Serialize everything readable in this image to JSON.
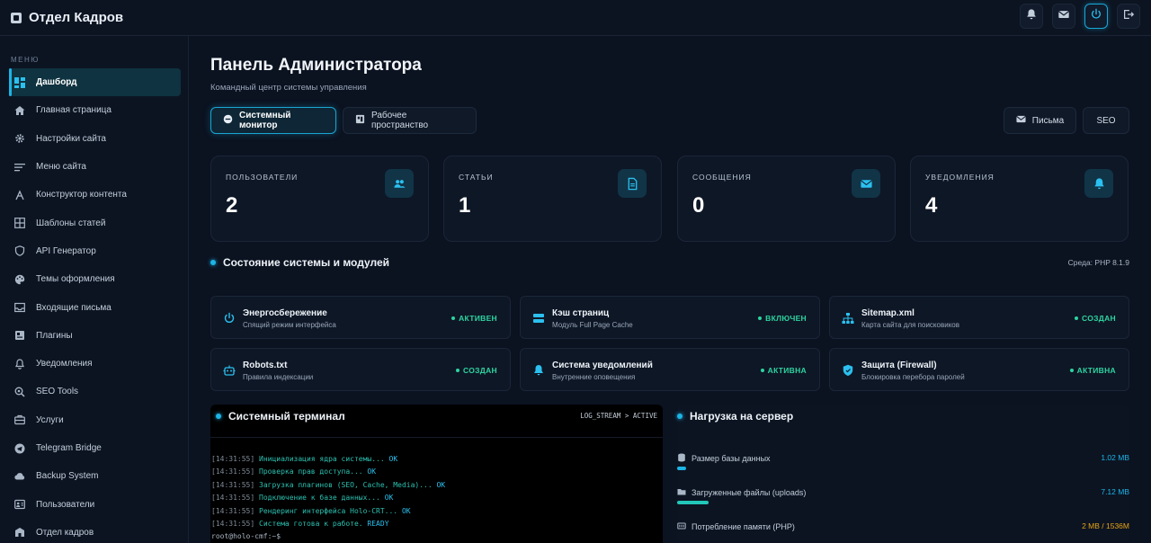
{
  "app": {
    "title": "Отдел Кадров"
  },
  "sidebar": {
    "menu_label": "МЕНЮ",
    "items": [
      {
        "label": "Дашборд",
        "icon": "dashboard-icon",
        "active": true
      },
      {
        "label": "Главная страница",
        "icon": "home-icon"
      },
      {
        "label": "Настройки сайта",
        "icon": "gear-icon"
      },
      {
        "label": "Меню сайта",
        "icon": "menu-list-icon"
      },
      {
        "label": "Конструктор контента",
        "icon": "constructor-icon"
      },
      {
        "label": "Шаблоны статей",
        "icon": "grid-icon"
      },
      {
        "label": "API Генератор",
        "icon": "shield-icon"
      },
      {
        "label": "Темы оформления",
        "icon": "palette-icon"
      },
      {
        "label": "Входящие письма",
        "icon": "inbox-icon"
      },
      {
        "label": "Плагины",
        "icon": "plugin-icon"
      },
      {
        "label": "Уведомления",
        "icon": "bell-icon"
      },
      {
        "label": "SEO Tools",
        "icon": "seo-search-icon"
      },
      {
        "label": "Услуги",
        "icon": "briefcase-icon"
      },
      {
        "label": "Telegram Bridge",
        "icon": "telegram-icon"
      },
      {
        "label": "Backup System",
        "icon": "backup-icon"
      },
      {
        "label": "Пользователи",
        "icon": "users-icon"
      },
      {
        "label": "Отдел кадров",
        "icon": "hr-icon"
      }
    ]
  },
  "header": {
    "title": "Панель Администратора",
    "subtitle": "Командный центр системы управления"
  },
  "tabs": {
    "system_monitor": "Системный монитор",
    "workspace": "Рабочее пространство",
    "mail": "Письма",
    "seo": "SEO"
  },
  "stats": [
    {
      "label": "ПОЛЬЗОВАТЕЛИ",
      "value": "2",
      "icon": "users-icon"
    },
    {
      "label": "СТАТЬИ",
      "value": "1",
      "icon": "document-icon"
    },
    {
      "label": "СООБЩЕНИЯ",
      "value": "0",
      "icon": "envelope-icon"
    },
    {
      "label": "УВЕДОМЛЕНИЯ",
      "value": "4",
      "icon": "bell-icon"
    }
  ],
  "modules_section": {
    "title": "Состояние системы и модулей",
    "environment": "Среда: PHP 8.1.9"
  },
  "modules": [
    {
      "name": "Энергосбережение",
      "desc": "Спящий режим интерфейса",
      "status": "АКТИВЕН",
      "icon": "power-icon"
    },
    {
      "name": "Кэш страниц",
      "desc": "Модуль Full Page Cache",
      "status": "ВКЛЮЧЕН",
      "icon": "server-icon"
    },
    {
      "name": "Sitemap.xml",
      "desc": "Карта сайта для поисковиков",
      "status": "СОЗДАН",
      "icon": "sitemap-icon"
    },
    {
      "name": "Robots.txt",
      "desc": "Правила индексации",
      "status": "СОЗДАН",
      "icon": "robot-icon"
    },
    {
      "name": "Система уведомлений",
      "desc": "Внутренние оповещения",
      "status": "АКТИВНА",
      "icon": "bell-icon"
    },
    {
      "name": "Защита (Firewall)",
      "desc": "Блокировка перебора паролей",
      "status": "АКТИВНА",
      "icon": "shield-icon"
    }
  ],
  "terminal": {
    "title": "Системный терминал",
    "stream": "LOG_STREAM > ACTIVE",
    "lines": [
      {
        "ts": "[14:31:55]",
        "msg": "Инициализация ядра системы...",
        "res": "OK"
      },
      {
        "ts": "[14:31:55]",
        "msg": "Проверка прав доступа...",
        "res": "OK"
      },
      {
        "ts": "[14:31:55]",
        "msg": "Загрузка плагинов (SEO, Cache, Media)...",
        "res": "OK"
      },
      {
        "ts": "[14:31:55]",
        "msg": "Подключение к базе данных...",
        "res": "OK"
      },
      {
        "ts": "[14:31:55]",
        "msg": "Рендеринг интерфейса Holo-CRT...",
        "res": "OK"
      },
      {
        "ts": "[14:31:55]",
        "msg": "Система готова к работе.",
        "res": "READY"
      }
    ],
    "prompt": "root@holo-cmf:~$"
  },
  "server_load": {
    "title": "Нагрузка на сервер",
    "rows": [
      {
        "label": "Размер базы данных",
        "value": "1.02 MB",
        "fill_fraction": 0.02,
        "icon": "database-icon"
      },
      {
        "label": "Загруженные файлы (uploads)",
        "value": "7.12 MB",
        "fill_fraction": 0.07,
        "icon": "folder-icon"
      },
      {
        "label": "Потребление памяти (PHP)",
        "value": "2 MB / 1536M",
        "fill_fraction": 0.0013,
        "icon": "memory-icon"
      }
    ]
  },
  "colors": {
    "accent": "#1cb4e6",
    "success": "#2dd4a0",
    "warning": "#e8a317",
    "background": "#0b1220"
  }
}
